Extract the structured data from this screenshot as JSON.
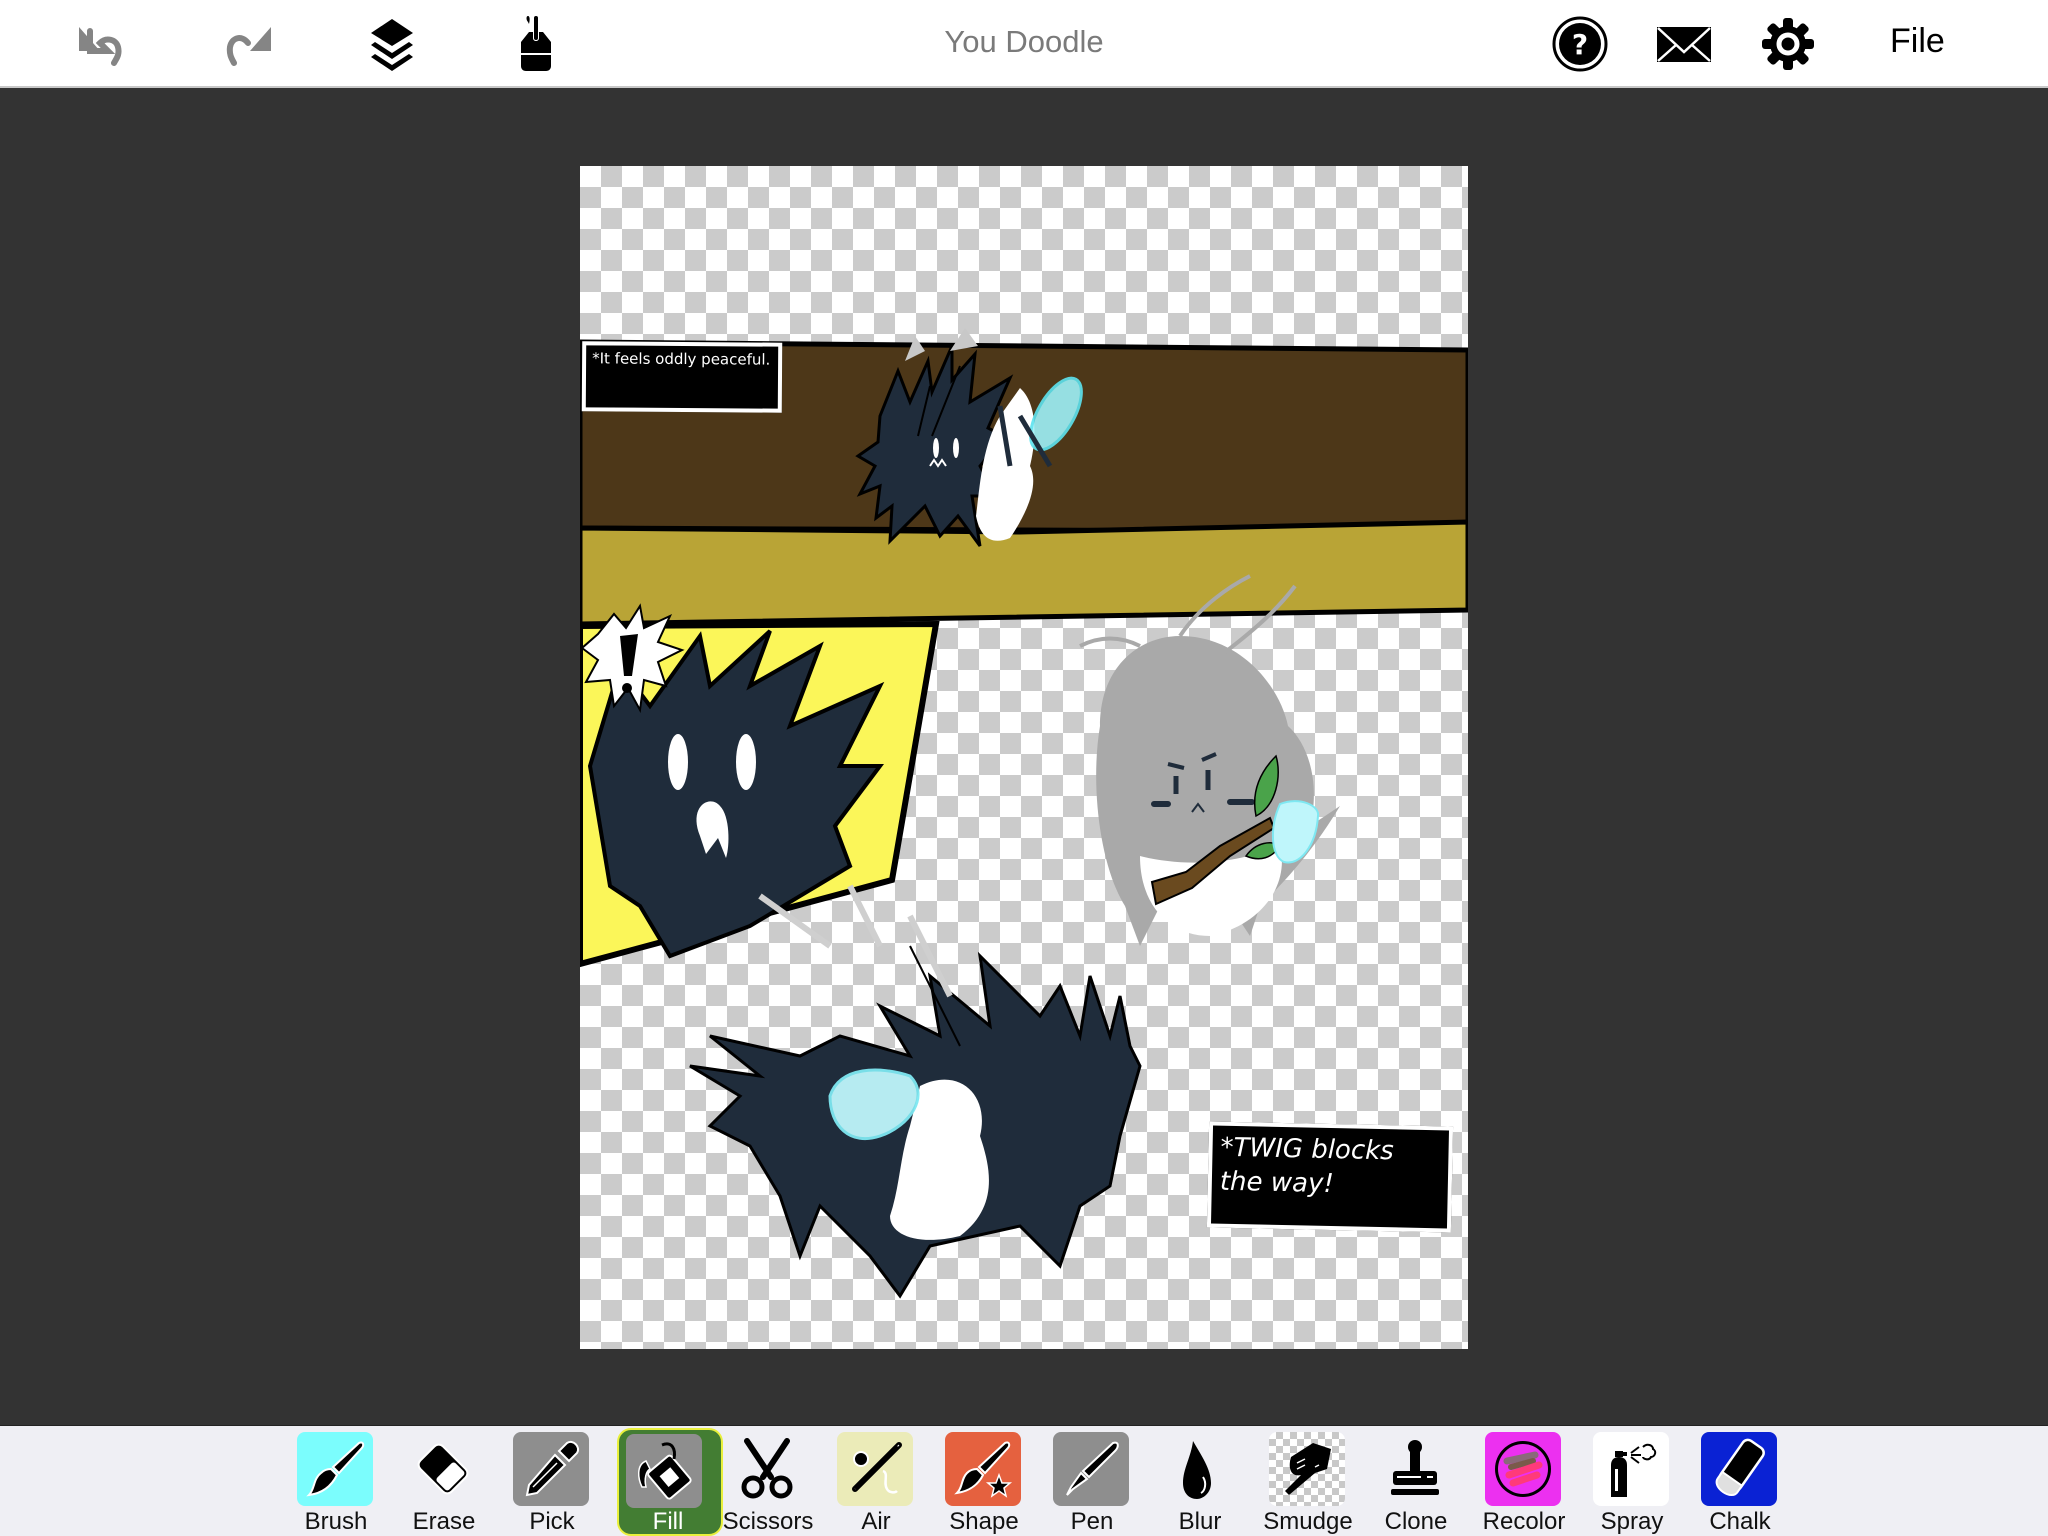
{
  "app": {
    "title": "You Doodle"
  },
  "topbar": {
    "left_buttons": [
      {
        "name": "undo",
        "icon": "undo-icon"
      },
      {
        "name": "redo",
        "icon": "redo-icon"
      },
      {
        "name": "layers",
        "icon": "layers-icon"
      },
      {
        "name": "paint-bucket-tools",
        "icon": "paint-pot-icon"
      }
    ],
    "right_buttons": [
      {
        "name": "help",
        "icon": "help-circle-icon"
      },
      {
        "name": "mail",
        "icon": "envelope-icon"
      },
      {
        "name": "settings",
        "icon": "gear-icon"
      }
    ],
    "file_label": "File"
  },
  "canvas": {
    "captions": [
      {
        "text": "*It feels oddly peaceful."
      },
      {
        "text": "*TWIG blocks the way!"
      }
    ],
    "colors": {
      "wall_brown": "#4d3718",
      "floor_ochre": "#b9a436",
      "panel_yellow": "#fbf659",
      "creature_dark": "#1f2c3b",
      "wing_cyan": "#bff6fb",
      "twig_brown": "#6a4a1f",
      "leaf_green": "#4aa34a",
      "grey_creature": "#a9a9a9"
    }
  },
  "toolbar": {
    "selected": "Fill",
    "tools": [
      {
        "label": "Brush",
        "icon": "paintbrush-icon",
        "bg": "#7bfdfd"
      },
      {
        "label": "Erase",
        "icon": "eraser-icon",
        "bg": "transparent"
      },
      {
        "label": "Pick",
        "icon": "eyedropper-icon",
        "bg": "#8e8e8e"
      },
      {
        "label": "Fill",
        "icon": "paint-bucket-icon",
        "bg": "#8e8e8e"
      },
      {
        "label": "Scissors",
        "icon": "scissors-icon",
        "bg": "transparent"
      },
      {
        "label": "Air",
        "icon": "airbrush-icon",
        "bg": "#ebebb8"
      },
      {
        "label": "Shape",
        "icon": "brush-star-icon",
        "bg": "#e5613f"
      },
      {
        "label": "Pen",
        "icon": "fountain-pen-icon",
        "bg": "#8e8e8e"
      },
      {
        "label": "Blur",
        "icon": "droplet-icon",
        "bg": "transparent"
      },
      {
        "label": "Smudge",
        "icon": "smudge-finger-icon",
        "bg": "checker"
      },
      {
        "label": "Clone",
        "icon": "stamp-icon",
        "bg": "transparent"
      },
      {
        "label": "Recolor",
        "icon": "recolor-circle-icon",
        "bg": "#ec30f0"
      },
      {
        "label": "Spray",
        "icon": "spray-can-icon",
        "bg": "#ffffff"
      },
      {
        "label": "Chalk",
        "icon": "chalk-icon",
        "bg": "#0a22d4"
      }
    ]
  }
}
